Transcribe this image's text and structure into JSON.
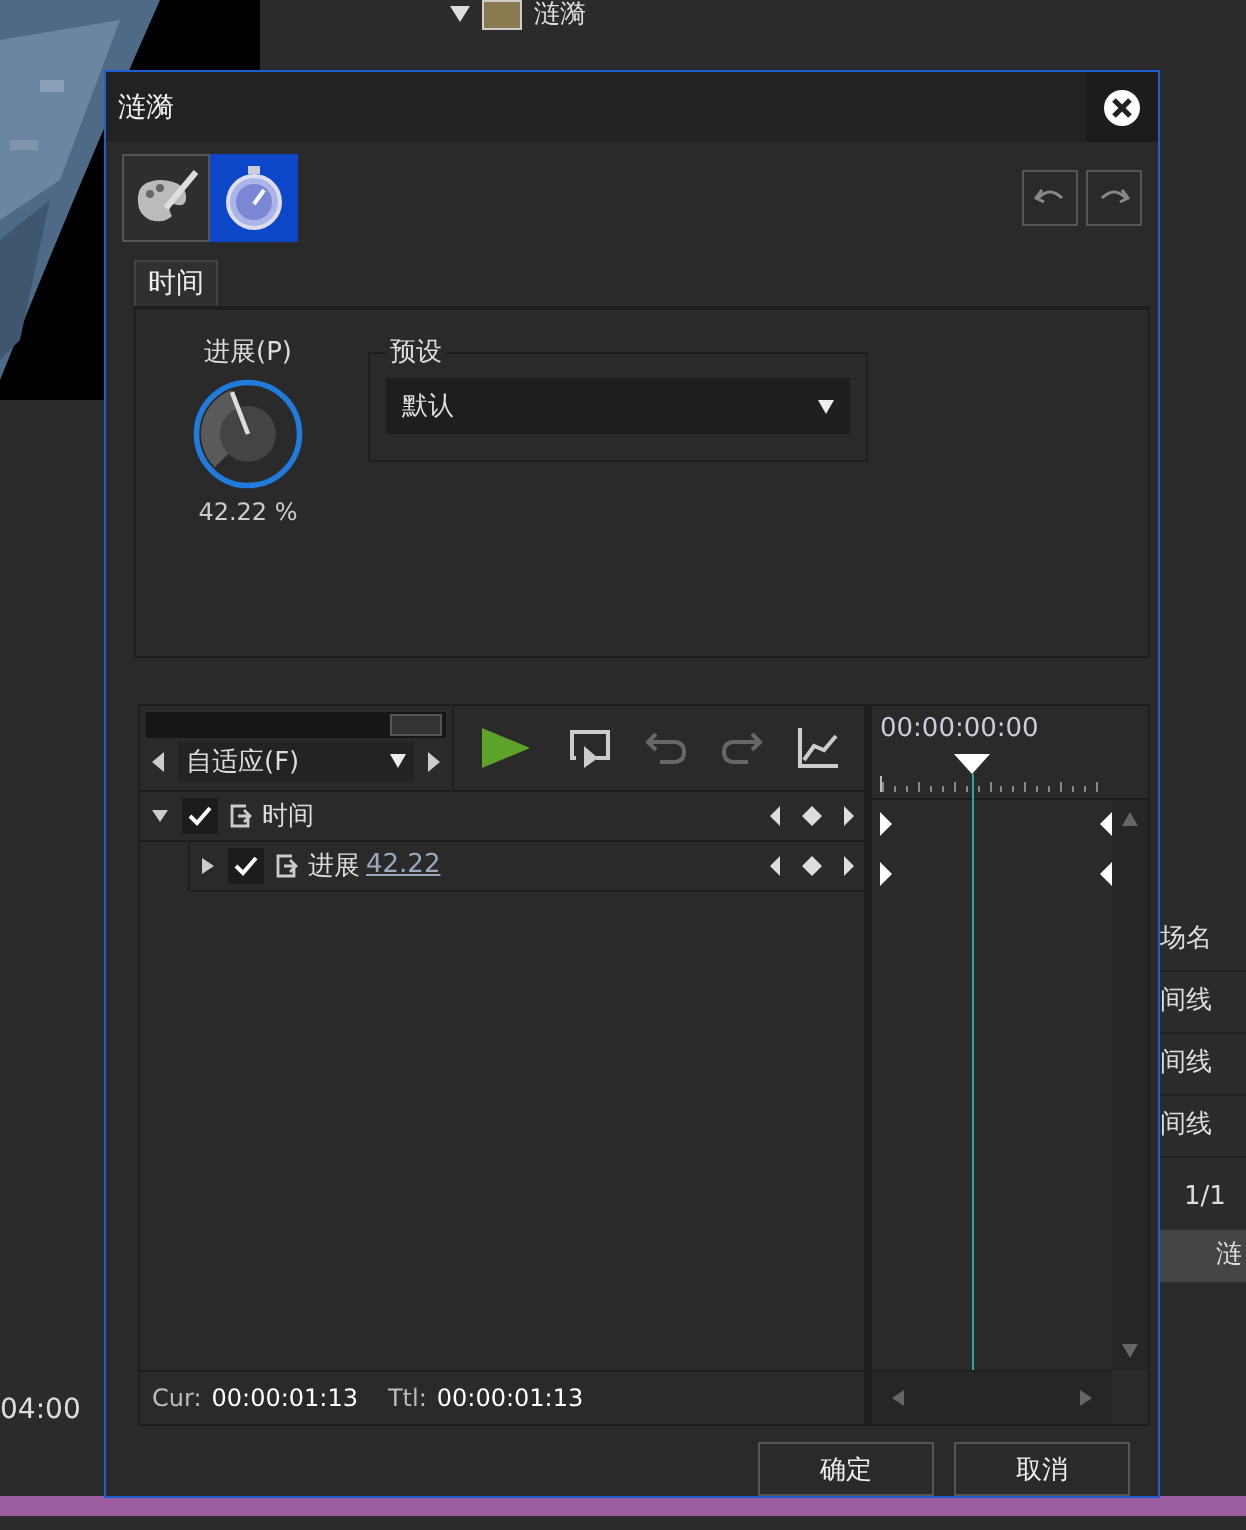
{
  "background": {
    "tree_item": "涟漪",
    "side_rows": [
      "场名",
      "间线",
      "间线",
      "间线"
    ],
    "page_count": "1/1",
    "clip": {
      "label": "涟",
      "selected": true
    },
    "timecode": "04:00"
  },
  "dialog": {
    "title": "涟漪",
    "tools": [
      {
        "kind": "palette",
        "selected": false
      },
      {
        "kind": "stopwatch",
        "selected": true
      }
    ],
    "tabs": [
      {
        "label": "时间",
        "selected": true
      }
    ],
    "knob": {
      "label": "进展(P)",
      "reading": "42.22 %"
    },
    "preset": {
      "legend": "预设",
      "value": "默认"
    },
    "zoom_slider": {
      "level": 1
    },
    "zoom_select": "自适应(F)",
    "timecode": "00:00:00:00",
    "tracks": [
      {
        "label": "时间",
        "expanded": true,
        "checked": true,
        "children": [
          {
            "label": "进展",
            "value": "42.22",
            "expanded": false,
            "checked": true
          }
        ]
      }
    ],
    "footer": {
      "cur_label": "Cur:",
      "cur": "00:00:01:13",
      "ttl_label": "Ttl:",
      "ttl": "00:00:01:13"
    },
    "buttons": [
      "确定",
      "取消"
    ]
  }
}
